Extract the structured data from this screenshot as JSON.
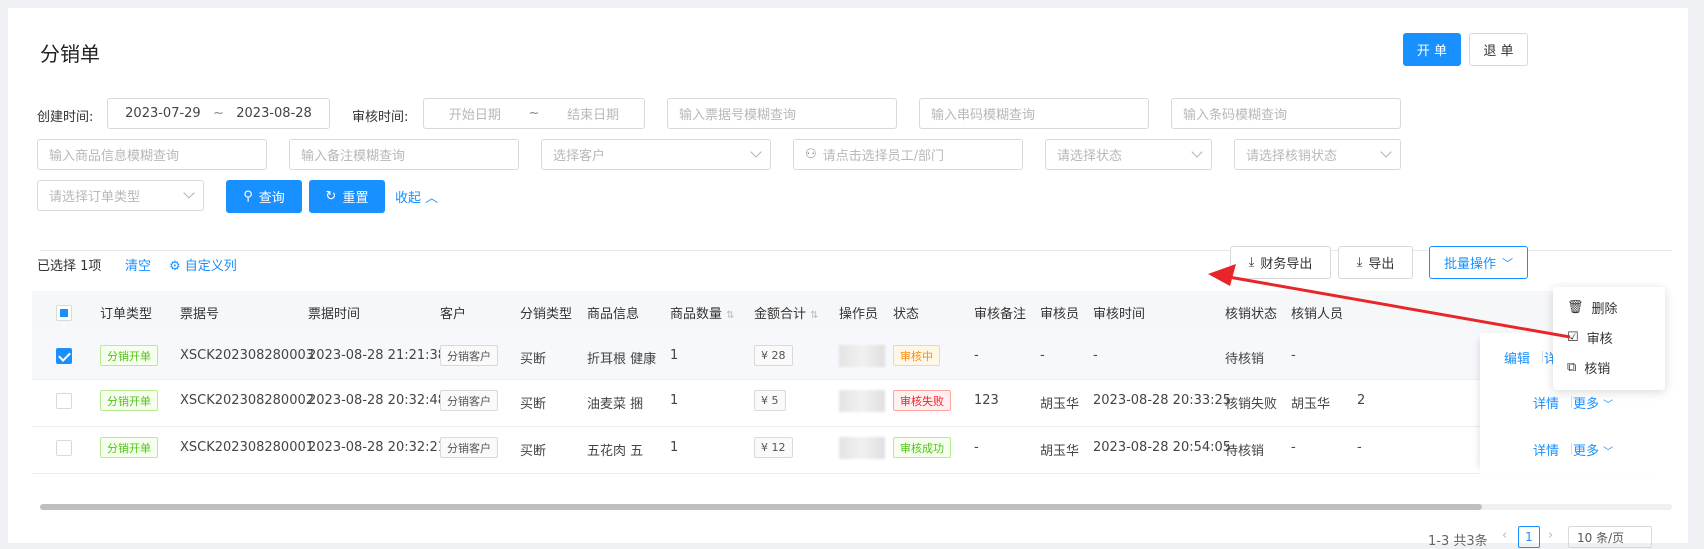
{
  "header": {
    "title": "分销单",
    "open_btn": "开 单",
    "return_btn": "退 单"
  },
  "filters": {
    "create_time_label": "创建时间:",
    "create_start": "2023-07-29",
    "range_sep": "~",
    "create_end": "2023-08-28",
    "audit_time_label": "审核时间:",
    "audit_start_ph": "开始日期",
    "audit_end_ph": "结束日期",
    "bill_no_ph": "输入票据号模糊查询",
    "serial_ph": "输入串码模糊查询",
    "barcode_ph": "输入条码模糊查询",
    "goods_ph": "输入商品信息模糊查询",
    "remark_ph": "输入备注模糊查询",
    "customer_ph": "选择客户",
    "staff_ph": "请点击选择员工/部门",
    "status_ph": "请选择状态",
    "writeoff_ph": "请选择核销状态",
    "order_type_ph": "请选择订单类型",
    "query_btn": "查询",
    "reset_btn": "重置",
    "collapse": "收起"
  },
  "toolbar": {
    "selected": "已选择 1项",
    "clear": "清空",
    "custom_cols": "自定义列",
    "finance_export": "财务导出",
    "export": "导出",
    "batch": "批量操作"
  },
  "batch_menu": [
    "删除",
    "审核",
    "核销"
  ],
  "table": {
    "headers": [
      "订单类型",
      "票据号",
      "票据时间",
      "客户",
      "分销类型",
      "商品信息",
      "商品数量",
      "金额合计",
      "操作员",
      "状态",
      "审核备注",
      "审核员",
      "审核时间",
      "核销状态",
      "核销人员"
    ],
    "rows": [
      {
        "order_type": "分销开单",
        "bill_no": "XSCK202308280003",
        "bill_time": "2023-08-28 21:21:38",
        "customer": "分销客户",
        "dist_type": "买断",
        "goods": "折耳根 健康",
        "qty": "1",
        "amount": "¥ 28",
        "status": "审核中",
        "remark": "-",
        "auditor": "-",
        "audit_time": "-",
        "writeoff": "待核销",
        "writeoff_person": "-",
        "act1": "编辑",
        "act2": "详"
      },
      {
        "order_type": "分销开单",
        "bill_no": "XSCK202308280002",
        "bill_time": "2023-08-28 20:32:48",
        "customer": "分销客户",
        "dist_type": "买断",
        "goods": "油麦菜 捆",
        "qty": "1",
        "amount": "¥ 5",
        "status": "审核失败",
        "remark": "123",
        "auditor": "胡玉华",
        "audit_time": "2023-08-28 20:33:25",
        "writeoff": "核销失败",
        "writeoff_person": "胡玉华",
        "extra": "2",
        "act1": "详情",
        "act2": "更多"
      },
      {
        "order_type": "分销开单",
        "bill_no": "XSCK202308280001",
        "bill_time": "2023-08-28 20:32:21",
        "customer": "分销客户",
        "dist_type": "买断",
        "goods": "五花肉 五",
        "qty": "1",
        "amount": "¥ 12",
        "status": "审核成功",
        "remark": "-",
        "auditor": "胡玉华",
        "audit_time": "2023-08-28 20:54:05",
        "writeoff": "待核销",
        "writeoff_person": "-",
        "extra": "-",
        "act1": "详情",
        "act2": "更多"
      }
    ]
  },
  "pagination": {
    "summary": "1-3 共3条",
    "page": "1",
    "size": "10 条/页"
  },
  "colors": {
    "primary": "#1890ff",
    "annotation_arrow": "#e8262a"
  }
}
